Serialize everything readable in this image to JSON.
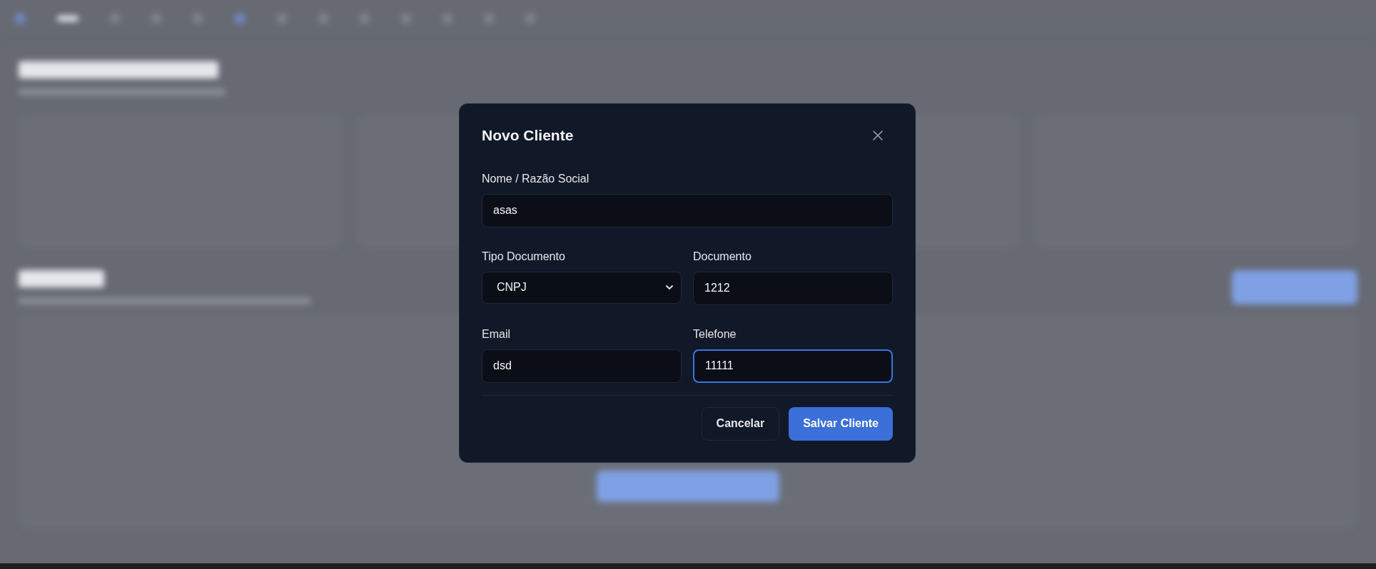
{
  "dialog": {
    "title": "Novo Cliente",
    "rows": [
      [
        {
          "kind": "text",
          "label": "Nome / Razão Social",
          "value": "asas",
          "focused": false
        }
      ],
      [
        {
          "kind": "select",
          "label": "Tipo Documento",
          "value": "CNPJ",
          "focused": false
        },
        {
          "kind": "text",
          "label": "Documento",
          "value": "1212",
          "focused": false
        }
      ],
      [
        {
          "kind": "text",
          "label": "Email",
          "value": "dsd",
          "focused": false
        },
        {
          "kind": "text",
          "label": "Telefone",
          "value": "11111",
          "focused": true
        }
      ]
    ],
    "buttons": [
      {
        "label": "Cancelar",
        "kind": "secondary"
      },
      {
        "label": "Salvar Cliente",
        "kind": "primary"
      }
    ]
  }
}
